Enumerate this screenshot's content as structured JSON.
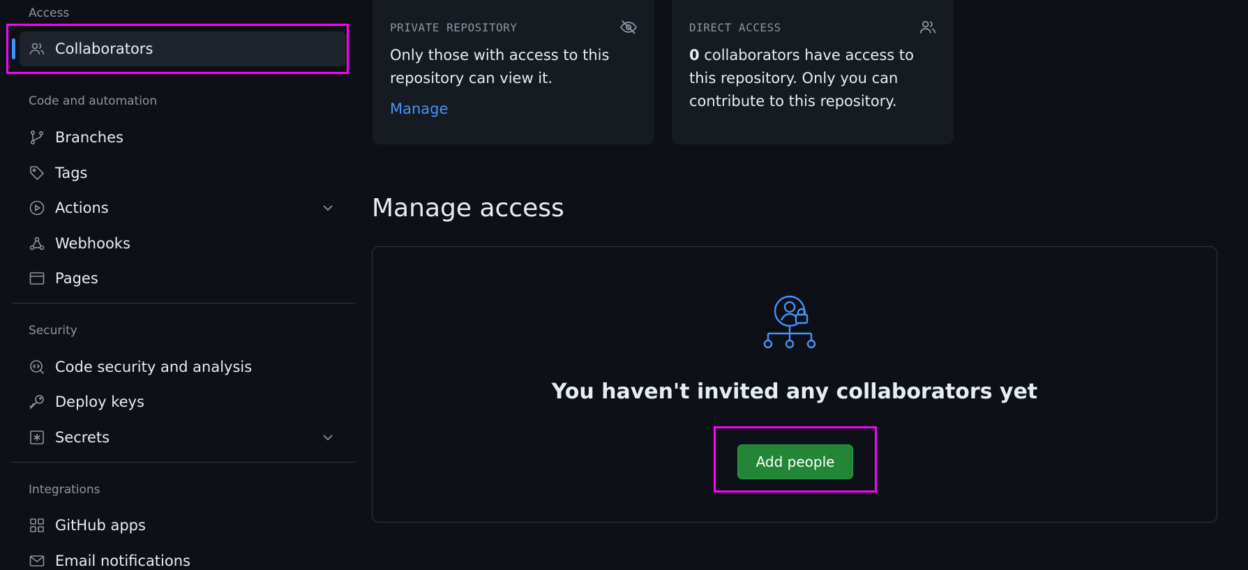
{
  "sidebar": {
    "groups": {
      "access": "Access",
      "code_automation": "Code and automation",
      "security": "Security",
      "integrations": "Integrations"
    },
    "items": {
      "collaborators": "Collaborators",
      "branches": "Branches",
      "tags": "Tags",
      "actions": "Actions",
      "webhooks": "Webhooks",
      "pages": "Pages",
      "code_security": "Code security and analysis",
      "deploy_keys": "Deploy keys",
      "secrets": "Secrets",
      "github_apps": "GitHub apps",
      "email_notifications": "Email notifications"
    }
  },
  "cards": {
    "private": {
      "title": "PRIVATE REPOSITORY",
      "body": "Only those with access to this repository can view it.",
      "link": "Manage"
    },
    "direct": {
      "title": "DIRECT ACCESS",
      "count": "0",
      "body": " collaborators have access to this repository. Only you can contribute to this repository."
    }
  },
  "manage": {
    "title": "Manage access",
    "empty_message": "You haven't invited any collaborators yet",
    "add_button": "Add people"
  },
  "colors": {
    "accent": "#4493f8",
    "button_green": "#238636",
    "highlight": "#ff00ff"
  }
}
